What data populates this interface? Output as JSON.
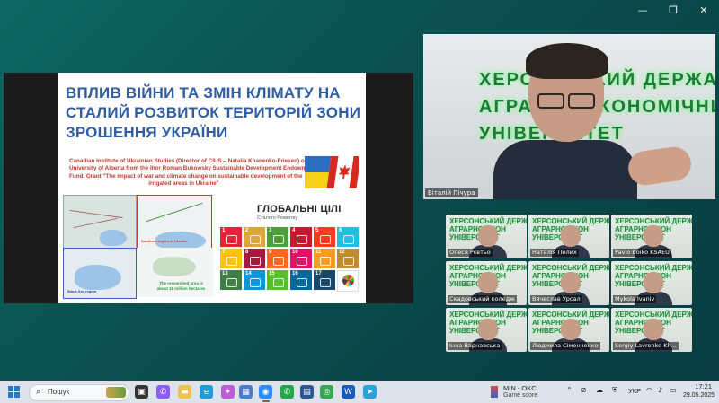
{
  "window": {
    "minimize": "—",
    "restore": "❐",
    "close": "✕"
  },
  "slide": {
    "title_lines": [
      "ВПЛИВ ВІЙНИ ТА ЗМІН КЛІМАТУ НА",
      "СТАЛИЙ РОЗВИТОК ТЕРИТОРІЙ ЗОНИ",
      "ЗРОШЕННЯ УКРАЇНИ"
    ],
    "grant_lines": [
      "Canadian Institute of Ukrainian Studies (Director of CIUS – Natalia Khanenko-Friesen) of the",
      "University of Alberta from the Ihor Roman Bukowsky Sustainable Development Endowment",
      "Fund. Grant \"The impact of war and climate change on sustainable development of the",
      "irrigated areas in Ukraine\""
    ],
    "map_labels": {
      "southern_region": "Southern region of Ukraine",
      "black_sea": "Black Sea region"
    },
    "area_note": [
      "The researched area is",
      "about 11 million hectares"
    ],
    "sdg_title": "ГЛОБАЛЬНІ ЦІЛІ",
    "sdg_subtitle": "Сталого Розвитку",
    "sdg_colors": [
      "#e5243b",
      "#dda63a",
      "#4c9f38",
      "#c5192d",
      "#ff3a21",
      "#26bde2",
      "#fcc30b",
      "#a21942",
      "#fd6925",
      "#dd1367",
      "#fd9d24",
      "#bf8b2e",
      "#3f7e44",
      "#0a97d9",
      "#56c02b",
      "#00689d",
      "#19486a"
    ]
  },
  "speaker": {
    "name": "Віталій Пічура",
    "wall_lines": [
      "ХЕРСОНСЬКИЙ ДЕРЖАВНИЙ",
      "АГРАРНО-ЕКОНОМІЧНИЙ",
      "УНІВЕРСИТЕТ"
    ]
  },
  "participants": [
    {
      "name": "Олеся Рєвтьо"
    },
    {
      "name": "Наталія Пелих"
    },
    {
      "name": "Pavlo Boiko KSAEU"
    },
    {
      "name": "Скадовський коледж"
    },
    {
      "name": "Вячеслав Урсал"
    },
    {
      "name": "Mykola Ivaniv"
    },
    {
      "name": "Інна Варнавська"
    },
    {
      "name": "Людмила Сімонченко"
    },
    {
      "name": "Sergiy Lavrenko Kh..."
    }
  ],
  "participant_wall": [
    "ХЕРСОНСЬКИЙ ДЕРЖ",
    "АГРАРНО-ЕКОН",
    "УНІВЕРСИТЕТ"
  ],
  "taskbar": {
    "search_placeholder": "Пошук",
    "widget_title": "MIN - OKC",
    "widget_subtitle": "Game score",
    "language": "УКР",
    "time": "17:21",
    "date": "29.05.2025"
  }
}
